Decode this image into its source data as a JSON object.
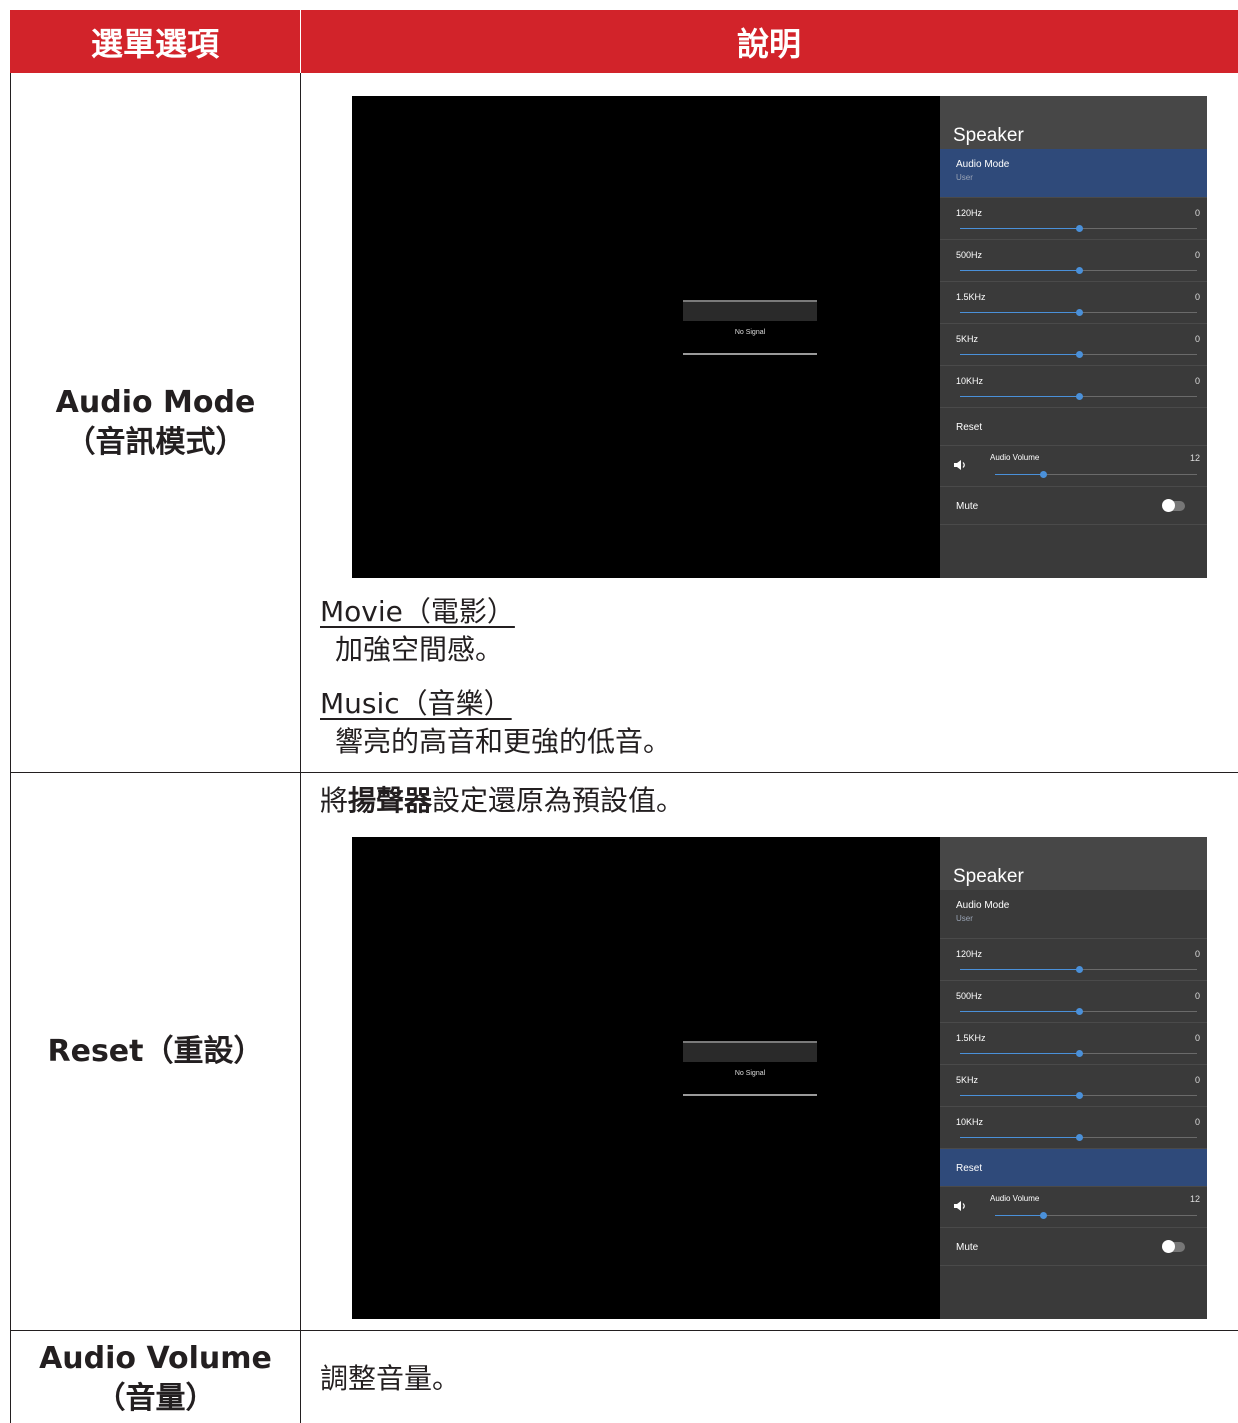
{
  "header": {
    "col1": "選單選項",
    "col2": "說明"
  },
  "rows": {
    "audio_mode": {
      "label_line1": "Audio Mode",
      "label_line2": "（音訊模式）",
      "movie_title": "Movie（電影）",
      "movie_desc": "加強空間感。",
      "music_title": "Music（音樂）",
      "music_desc": "響亮的高音和更強的低音。"
    },
    "reset": {
      "label": "Reset（重設）",
      "desc_pre": "將",
      "desc_bold": "揚聲器",
      "desc_post": "設定還原為預設值。"
    },
    "audio_volume": {
      "label_line1": "Audio Volume",
      "label_line2": "（音量）",
      "desc": "調整音量。"
    }
  },
  "osd": {
    "no_signal": "No Signal",
    "panel_title": "Speaker",
    "audio_mode": {
      "label": "Audio Mode",
      "value": "User"
    },
    "bands": [
      {
        "label": "120Hz",
        "value": "0",
        "level": 0.5
      },
      {
        "label": "500Hz",
        "value": "0",
        "level": 0.5
      },
      {
        "label": "1.5KHz",
        "value": "0",
        "level": 0.5
      },
      {
        "label": "5KHz",
        "value": "0",
        "level": 0.5
      },
      {
        "label": "10KHz",
        "value": "0",
        "level": 0.5
      }
    ],
    "reset_label": "Reset",
    "volume": {
      "label": "Audio Volume",
      "value": "12",
      "level": 0.12
    },
    "mute_label": "Mute",
    "mute_on": false,
    "highlight_color": "#2f4a7a",
    "slider_color": "#4a90d9"
  },
  "colors": {
    "header_bg": "#d2232a",
    "text": "#231f20"
  }
}
